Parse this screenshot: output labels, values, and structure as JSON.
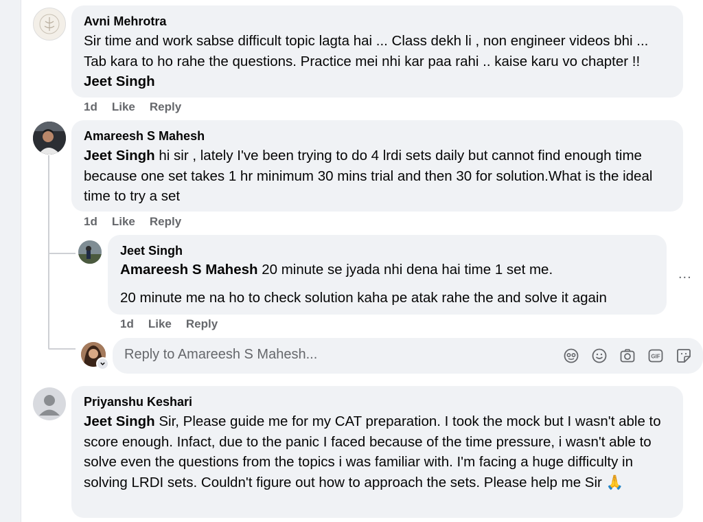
{
  "comments": [
    {
      "author": "Avni Mehrotra",
      "text": "Sir time and work sabse difficult topic lagta hai ... Class dekh li , non engineer videos bhi ... Tab kara to ho rahe the questions. Practice mei nhi kar paa rahi .. kaise karu vo chapter !! ",
      "mention": "Jeet Singh",
      "time": "1d",
      "like": "Like",
      "reply": "Reply"
    },
    {
      "author": "Amareesh S Mahesh",
      "mention": "Jeet Singh",
      "text": " hi sir , lately I've been trying to do 4 lrdi sets daily but cannot find enough time because one set takes 1 hr minimum 30 mins trial and then 30 for solution.What is the ideal time to try a set",
      "time": "1d",
      "like": "Like",
      "reply": "Reply",
      "replies": [
        {
          "author": "Jeet Singh",
          "mention": "Amareesh S Mahesh",
          "text_line1": " 20 minute se jyada nhi dena hai time 1 set me.",
          "text_line2": "20 minute me na ho to check solution kaha pe atak rahe the and solve it again",
          "time": "1d",
          "like": "Like",
          "reply": "Reply"
        }
      ],
      "reply_box": {
        "placeholder": "Reply to Amareesh S Mahesh...",
        "tools": [
          "avatar-sticker-icon",
          "emoji-icon",
          "camera-icon",
          "gif-icon",
          "sticker-icon"
        ],
        "gif_label": "GIF"
      }
    },
    {
      "author": "Priyanshu Keshari",
      "mention": "Jeet Singh",
      "text": " Sir, Please guide me for my CAT preparation. I took the mock but I wasn't able to score enough. Infact, due to the panic I faced because of the time pressure, i wasn't able to solve even the questions from the topics i was familiar with. I'm facing a huge difficulty in solving LRDI sets. Couldn't figure out how to approach the sets. Please help me Sir ",
      "emoji": "🙏"
    }
  ],
  "more_label": "...",
  "colors": {
    "bubble": "#f0f2f5",
    "meta": "#65676b",
    "text": "#050505"
  }
}
